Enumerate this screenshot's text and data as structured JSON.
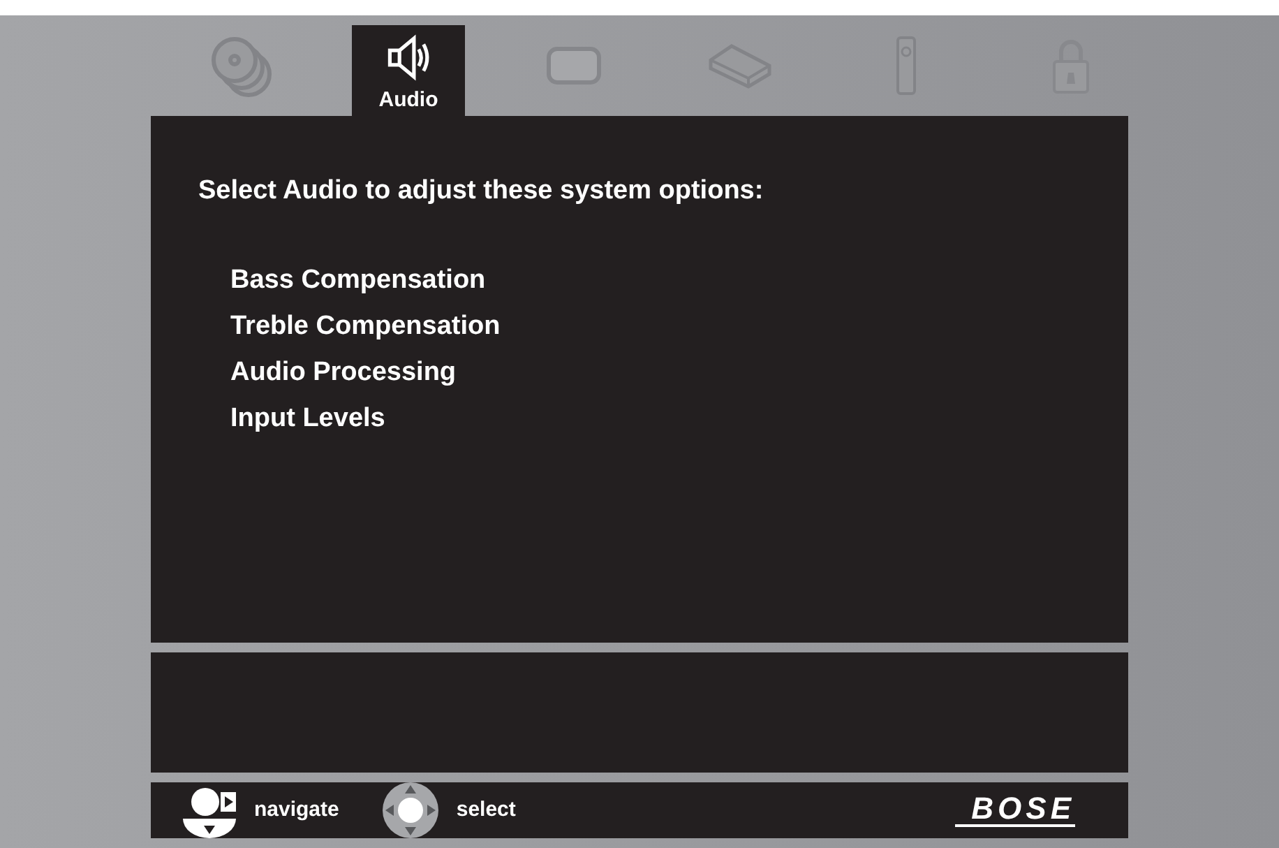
{
  "tabs": [
    {
      "kind": "discs",
      "selected": false
    },
    {
      "kind": "speaker",
      "label": "Audio",
      "selected": true
    },
    {
      "kind": "tv",
      "selected": false
    },
    {
      "kind": "device",
      "selected": false
    },
    {
      "kind": "remote",
      "selected": false
    },
    {
      "kind": "lock",
      "selected": false
    }
  ],
  "heading": "Select Audio to adjust these system options:",
  "options": [
    "Bass Compensation",
    "Treble Compensation",
    "Audio Processing",
    "Input Levels"
  ],
  "hints": [
    {
      "kind": "navigate",
      "label": "navigate"
    },
    {
      "kind": "select",
      "label": "select"
    }
  ],
  "brand": "BOSE"
}
